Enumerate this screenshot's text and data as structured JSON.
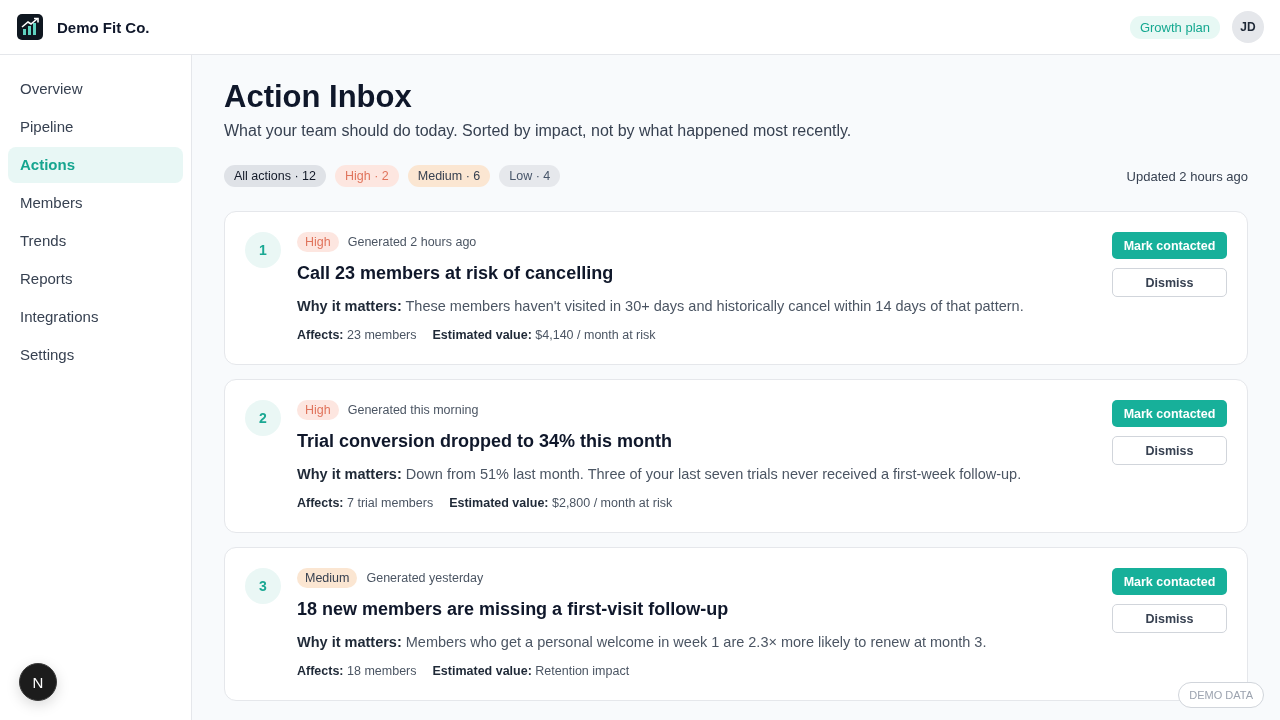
{
  "header": {
    "brand": "Demo Fit Co.",
    "plan": "Growth plan",
    "avatar": "JD"
  },
  "sidebar": {
    "items": [
      {
        "label": "Overview",
        "selected": false
      },
      {
        "label": "Pipeline",
        "selected": false
      },
      {
        "label": "Actions",
        "selected": true
      },
      {
        "label": "Members",
        "selected": false
      },
      {
        "label": "Trends",
        "selected": false
      },
      {
        "label": "Reports",
        "selected": false
      },
      {
        "label": "Integrations",
        "selected": false
      },
      {
        "label": "Settings",
        "selected": false
      }
    ]
  },
  "main": {
    "title": "Action Inbox",
    "subtitle": "What your team should do today. Sorted by impact, not by what happened most recently.",
    "filters": [
      {
        "label": "All actions · 12",
        "kind": "all",
        "selected": true
      },
      {
        "label": "High · 2",
        "kind": "high",
        "selected": false
      },
      {
        "label": "Medium · 6",
        "kind": "medium",
        "selected": false
      },
      {
        "label": "Low · 4",
        "kind": "low",
        "selected": false
      }
    ],
    "updated": "Updated 2 hours ago",
    "actions": [
      {
        "number": "1",
        "priority": {
          "label": "High",
          "kind": "high"
        },
        "generated": "Generated 2 hours ago",
        "title": "Call 23 members at risk of cancelling",
        "why": "**Why it matters:** These members haven't visited in 30+ days and historically cancel within 14 days of that pattern.",
        "meta": [
          "**Affects:** 23 members",
          "**Estimated value:** $4,140 / month at risk"
        ],
        "buttons": [
          {
            "label": "Mark contacted",
            "kind": "primary"
          },
          {
            "label": "Dismiss",
            "kind": "secondary"
          }
        ]
      },
      {
        "number": "2",
        "priority": {
          "label": "High",
          "kind": "high"
        },
        "generated": "Generated this morning",
        "title": "Trial conversion dropped to 34% this month",
        "why": "**Why it matters:** Down from 51% last month. Three of your last seven trials never received a first-week follow-up.",
        "meta": [
          "**Affects:** 7 trial members",
          "**Estimated value:** $2,800 / month at risk"
        ],
        "buttons": [
          {
            "label": "Mark contacted",
            "kind": "primary"
          },
          {
            "label": "Dismiss",
            "kind": "secondary"
          }
        ]
      },
      {
        "number": "3",
        "priority": {
          "label": "Medium",
          "kind": "medium"
        },
        "generated": "Generated yesterday",
        "title": "18 new members are missing a first-visit follow-up",
        "why": "**Why it matters:** Members who get a personal welcome in week 1 are 2.3× more likely to renew at month 3.",
        "meta": [
          "**Affects:** 18 members",
          "**Estimated value:** Retention impact"
        ],
        "buttons": [
          {
            "label": "Mark contacted",
            "kind": "primary"
          },
          {
            "label": "Dismiss",
            "kind": "secondary"
          }
        ]
      }
    ]
  },
  "dev_indicator": "N",
  "demo_badge": "DEMO DATA"
}
